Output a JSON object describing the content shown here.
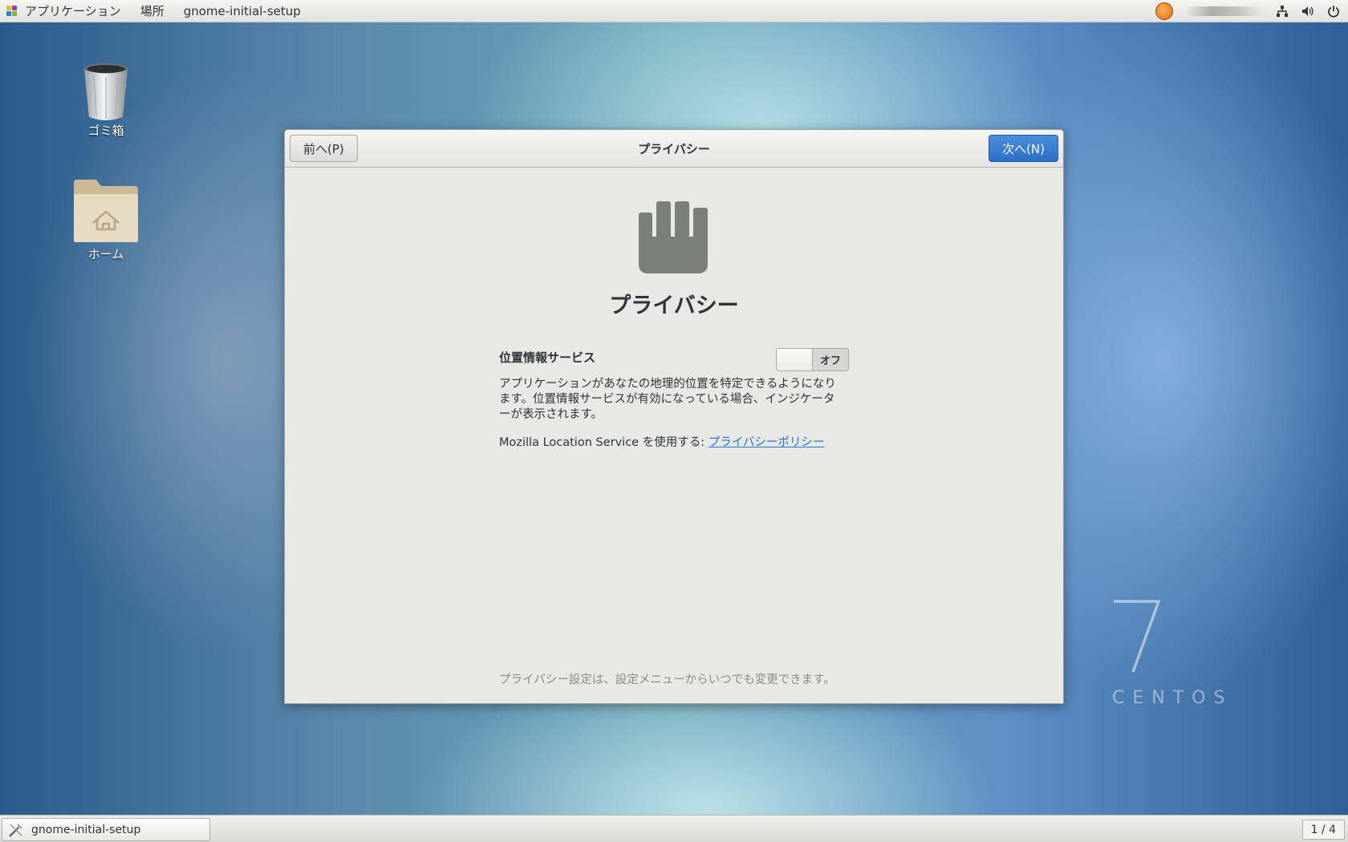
{
  "top_panel": {
    "applications_label": "アプリケーション",
    "places_label": "場所",
    "active_app_label": "gnome-initial-setup"
  },
  "desktop": {
    "icons": [
      {
        "label": "ゴミ箱",
        "icon": "trash-icon"
      },
      {
        "label": "ホーム",
        "icon": "home-folder-icon"
      }
    ]
  },
  "window": {
    "back_label": "前へ(P)",
    "title": "プライバシー",
    "next_label": "次へ(N)",
    "heading": "プライバシー",
    "location_services_label": "位置情報サービス",
    "location_switch_state": "オフ",
    "location_switch_on": false,
    "description": "アプリケーションがあなたの地理的位置を特定できるようになります。位置情報サービスが有効になっている場合、インジケーターが表示されます。",
    "mozilla_text": "Mozilla Location Service を使用する:",
    "privacy_policy_link": "プライバシーポリシー",
    "footer_note": "プライバシー設定は、設定メニューからいつでも変更できます。"
  },
  "branding": {
    "os_number": "7",
    "os_name": "CENTOS"
  },
  "bottom_panel": {
    "task_label": "gnome-initial-setup",
    "workspace_indicator": "1 / 4"
  },
  "colors": {
    "accent": "#2d6fc6",
    "link": "#2a76c6"
  }
}
